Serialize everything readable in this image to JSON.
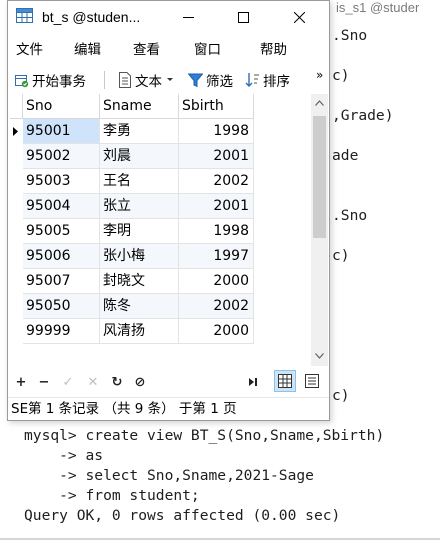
{
  "background_console": {
    "title_fragment": "is_s1 @studer",
    "lines": [
      ".Sno",
      "c)",
      ",Grade)",
      "ade",
      ".Sno",
      "c)",
      "c)"
    ],
    "bottom_lines": [
      "mysql> create view BT_S(Sno,Sname,Sbirth)",
      "    -> as",
      "    -> select Sno,Sname,2021-Sage",
      "    -> from student;",
      "Query OK, 0 rows affected (0.00 sec)"
    ]
  },
  "window": {
    "title": "bt_s @studen...",
    "controls": {
      "minimize": "minimize",
      "maximize": "maximize",
      "close": "close"
    }
  },
  "menu": [
    "文件",
    "编辑",
    "查看",
    "窗口",
    "帮助"
  ],
  "toolbar": {
    "begin_transaction": "开始事务",
    "text": "文本",
    "filter": "筛选",
    "sort": "排序",
    "more": "»"
  },
  "table": {
    "columns": [
      "Sno",
      "Sname",
      "Sbirth"
    ],
    "rows": [
      [
        "95001",
        "李勇",
        "1998"
      ],
      [
        "95002",
        "刘晨",
        "2001"
      ],
      [
        "95003",
        "王名",
        "2002"
      ],
      [
        "95004",
        "张立",
        "2001"
      ],
      [
        "95005",
        "李明",
        "1998"
      ],
      [
        "95006",
        "张小梅",
        "1997"
      ],
      [
        "95007",
        "封晓文",
        "2000"
      ],
      [
        "95050",
        "陈冬",
        "2002"
      ],
      [
        "99999",
        "风清扬",
        "2000"
      ]
    ],
    "selected_row": 0
  },
  "navbar": {
    "add": "+",
    "delete": "−",
    "apply": "✓",
    "cancel": "✕",
    "refresh": "↻",
    "stop": "⊘"
  },
  "status": {
    "left": "SE",
    "text": "第 1 条记录 （共 9 条） 于第 1 页"
  },
  "colors": {
    "accent": "#1a73d1",
    "selected_cell": "#cfe4fb",
    "alt_row": "#f4f8fc"
  }
}
